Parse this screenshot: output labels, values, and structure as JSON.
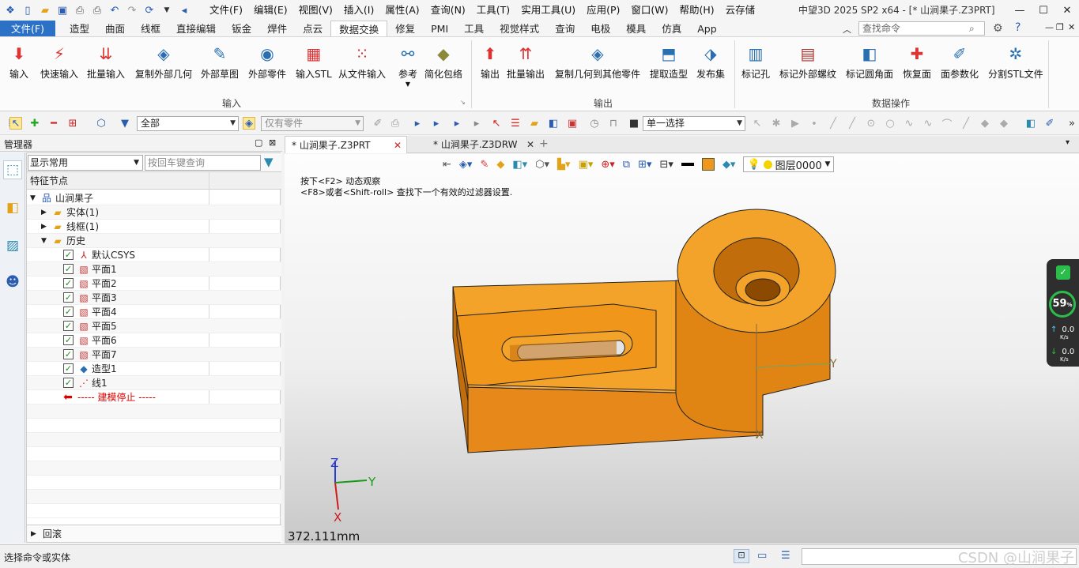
{
  "titlebar": {
    "menus": [
      "文件(F)",
      "编辑(E)",
      "视图(V)",
      "插入(I)",
      "属性(A)",
      "查询(N)",
      "工具(T)",
      "实用工具(U)",
      "应用(P)",
      "窗口(W)",
      "帮助(H)",
      "云存储"
    ],
    "window_title": "中望3D 2025 SP2 x64 - [* 山涧果子.Z3PRT]"
  },
  "ribbon_tabs": {
    "file": "文件(F)",
    "tabs": [
      "造型",
      "曲面",
      "线框",
      "直接编辑",
      "钣金",
      "焊件",
      "点云",
      "数据交换",
      "修复",
      "PMI",
      "工具",
      "视觉样式",
      "查询",
      "电极",
      "模具",
      "仿真",
      "App"
    ],
    "active": "数据交换",
    "search_placeholder": "查找命令"
  },
  "ribbon": {
    "input_buttons": [
      "输入",
      "快速输入",
      "批量输入",
      "复制外部几何",
      "外部草图",
      "外部零件",
      "输入STL",
      "从文件输入",
      "参考",
      "简化包络"
    ],
    "output_buttons": [
      "输出",
      "批量输出",
      "复制几何到其他零件",
      "提取造型",
      "发布集"
    ],
    "dataop_buttons": [
      "标记孔",
      "标记外部螺纹",
      "标记圆角面",
      "恢复面",
      "面参数化",
      "分割STL文件"
    ],
    "groups": {
      "input": "输入",
      "output": "输出",
      "dataop": "数据操作"
    }
  },
  "toolbar": {
    "filter_all": "全部",
    "filter_parts": "仅有零件",
    "select_mode": "单一选择"
  },
  "manager": {
    "title": "管理器",
    "display": "显示常用",
    "search_placeholder": "按回车键查询",
    "tree_header": "特征节点",
    "tree": [
      {
        "label": "山涧果子",
        "icon": "assembly-icon",
        "checked": null
      },
      {
        "label": "实体(1)",
        "icon": "solid-icon",
        "checked": null
      },
      {
        "label": "线框(1)",
        "icon": "wireframe-icon",
        "checked": null
      },
      {
        "label": "历史",
        "icon": "folder-icon",
        "checked": null
      },
      {
        "label": "默认CSYS",
        "icon": "csys-icon",
        "checked": true
      },
      {
        "label": "平面1",
        "icon": "plane-icon",
        "checked": true
      },
      {
        "label": "平面2",
        "icon": "plane-icon",
        "checked": true
      },
      {
        "label": "平面3",
        "icon": "plane-icon",
        "checked": true
      },
      {
        "label": "平面4",
        "icon": "plane-icon",
        "checked": true
      },
      {
        "label": "平面5",
        "icon": "plane-icon",
        "checked": true
      },
      {
        "label": "平面6",
        "icon": "plane-icon",
        "checked": true
      },
      {
        "label": "平面7",
        "icon": "plane-icon",
        "checked": true
      },
      {
        "label": "造型1",
        "icon": "shape-icon",
        "checked": true
      },
      {
        "label": "线1",
        "icon": "line-icon",
        "checked": true
      },
      {
        "label": "----- 建模停止 -----",
        "icon": "stop-arrow-icon",
        "checked": null
      }
    ],
    "rollback": "回滚"
  },
  "docs": {
    "tab1": "* 山涧果子.Z3PRT",
    "tab2": "* 山涧果子.Z3DRW",
    "layer": "图层0000"
  },
  "viewport": {
    "hint1": "按下<F2> 动态观察",
    "hint2": "<F8>或者<Shift-roll> 查找下一个有效的过滤器设置.",
    "dimension": "372.111mm",
    "axis_x": "X",
    "axis_y": "Y",
    "axis_z": "Z",
    "part_color": "#f0961a"
  },
  "netwidget": {
    "percent": "59",
    "unit": "%",
    "up": "0.0",
    "down": "0.0",
    "rate_unit": "K/s"
  },
  "status": {
    "text": "选择命令或实体"
  },
  "watermark": "CSDN @山涧果子"
}
